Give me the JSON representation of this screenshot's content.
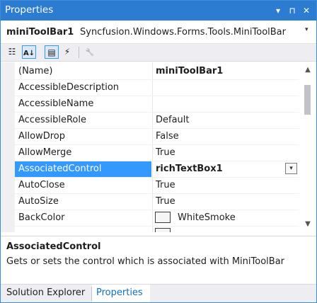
{
  "window": {
    "title": "Properties",
    "buttons": {
      "dropdown": "▾",
      "pin": "⊓",
      "close": "✕"
    }
  },
  "object_selector": {
    "name": "miniToolBar1",
    "type": "Syncfusion.Windows.Forms.Tools.MiniToolBar",
    "caret": "▾"
  },
  "toolbar": {
    "tools": [
      {
        "name": "categorized-icon",
        "glyph": "☷",
        "pressed": false
      },
      {
        "name": "alphabetical-icon",
        "glyph": "A↓",
        "pressed": true
      },
      {
        "name": "properties-icon",
        "glyph": "▤",
        "pressed": true
      },
      {
        "name": "events-icon",
        "glyph": "⚡",
        "pressed": false
      },
      {
        "name": "property-pages-icon",
        "glyph": "🔧",
        "pressed": false
      }
    ]
  },
  "grid": {
    "rows": [
      {
        "name": "(Name)",
        "value": "miniToolBar1",
        "bold": true
      },
      {
        "name": "AccessibleDescription",
        "value": ""
      },
      {
        "name": "AccessibleName",
        "value": ""
      },
      {
        "name": "AccessibleRole",
        "value": "Default"
      },
      {
        "name": "AllowDrop",
        "value": "False"
      },
      {
        "name": "AllowMerge",
        "value": "True"
      },
      {
        "name": "AssociatedControl",
        "value": "richTextBox1",
        "bold": true,
        "selected": true
      },
      {
        "name": "AutoClose",
        "value": "True"
      },
      {
        "name": "AutoSize",
        "value": "True"
      },
      {
        "name": "BackColor",
        "value": "WhiteSmoke",
        "swatch": true
      }
    ],
    "dropdown_glyph": "▾",
    "scroll_up": "▲",
    "scroll_down": "▼"
  },
  "description": {
    "title": "AssociatedControl",
    "text": "Gets or sets the control which is associated with MiniToolBar"
  },
  "tabs": [
    {
      "label": "Solution Explorer",
      "active": false
    },
    {
      "label": "Properties",
      "active": true
    }
  ],
  "colors": {
    "titlebar": "#2c7cd2",
    "selection": "#3399ff",
    "active_tab_text": "#0e70c0"
  }
}
